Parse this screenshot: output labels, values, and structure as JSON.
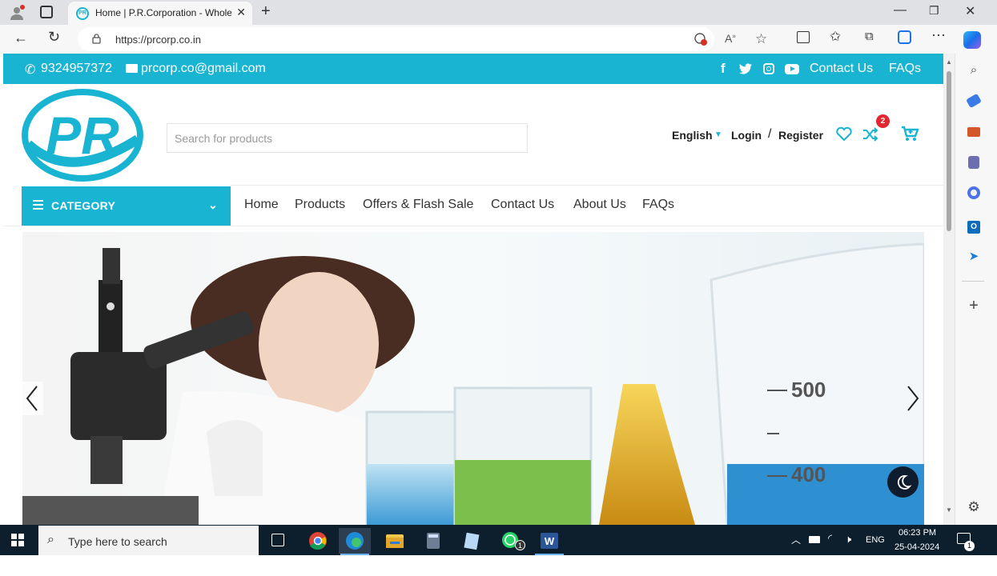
{
  "browser": {
    "tab_title": "Home | P.R.Corporation - Whole",
    "url": "https://prcorp.co.in"
  },
  "topbar": {
    "phone": "9324957372",
    "email": "prcorp.co@gmail.com",
    "contact_link": "Contact Us",
    "faqs_link": "FAQs"
  },
  "header": {
    "logo_text": "PR",
    "search_placeholder": "Search for products",
    "language": "English",
    "login": "Login",
    "separator": "/",
    "register": "Register",
    "compare_badge": "2"
  },
  "category": {
    "label": "CATEGORY"
  },
  "nav": {
    "items": [
      "Home",
      "Products",
      "Offers & Flash Sale",
      "Contact Us",
      "About Us",
      "FAQs"
    ]
  },
  "hero": {
    "beaker_mark_top": "500",
    "beaker_mark_bottom": "400"
  },
  "taskbar": {
    "search_placeholder": "Type here to search",
    "whatsapp_badge": "1",
    "lang": "ENG",
    "time": "06:23 PM",
    "date": "25-04-2024",
    "notif_badge": "1"
  },
  "colors": {
    "accent": "#1ab4d3",
    "badge_red": "#e3262f",
    "taskbar": "#0d1f2d"
  }
}
